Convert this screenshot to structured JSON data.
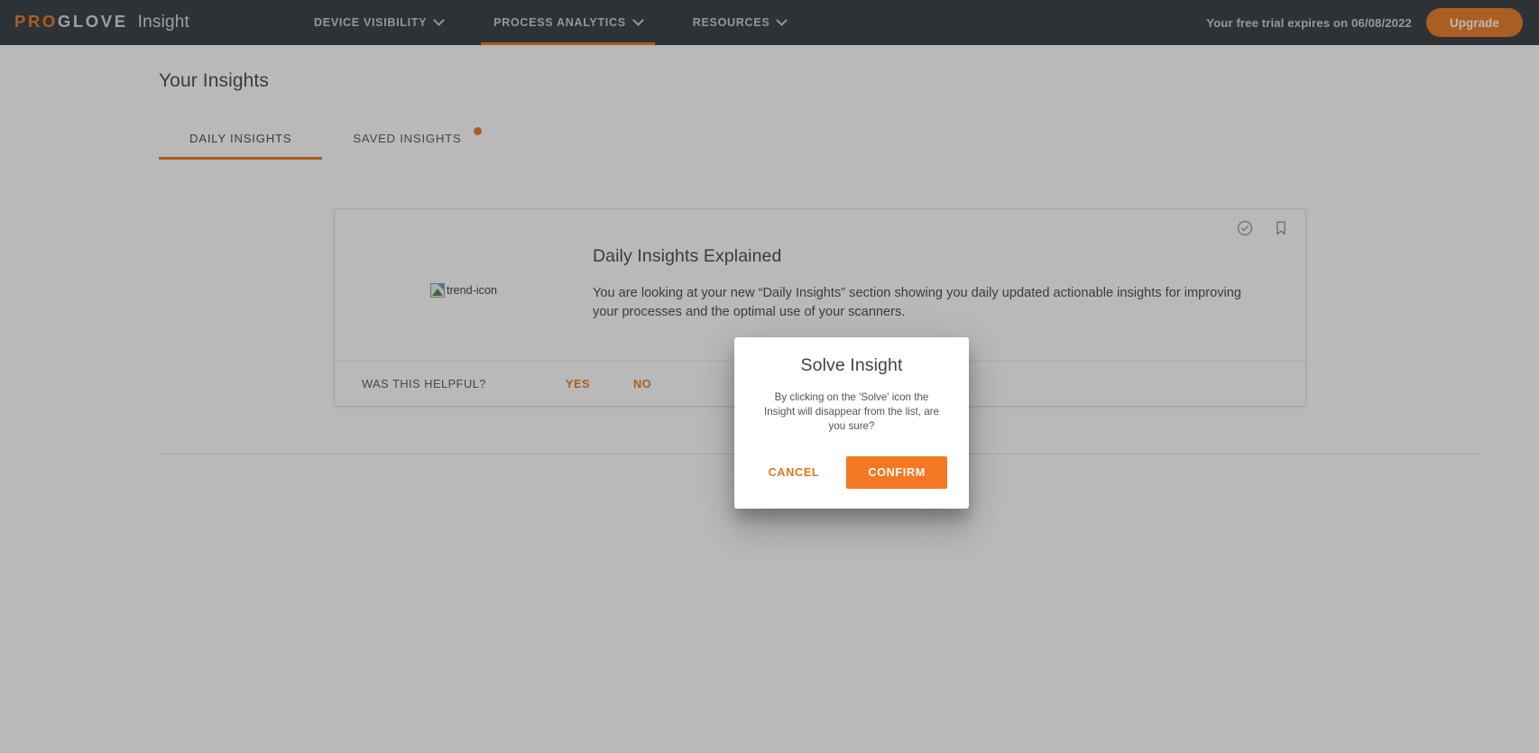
{
  "navbar": {
    "brand": {
      "logo_prefix": "PRO",
      "logo_suffix": "GLOVE",
      "product": "Insight"
    },
    "items": [
      {
        "label": "DEVICE VISIBILITY",
        "has_caret": true,
        "active": false
      },
      {
        "label": "PROCESS ANALYTICS",
        "has_caret": true,
        "active": true
      },
      {
        "label": "RESOURCES",
        "has_caret": true,
        "active": false
      }
    ],
    "trial_notice": "Your free trial expires on 06/08/2022",
    "upgrade_label": "Upgrade",
    "bg_color": "#2b3239",
    "accent_color": "#e8751a"
  },
  "page": {
    "title": "Your Insights",
    "tabs": [
      {
        "label": "DAILY INSIGHTS",
        "active": true,
        "badge": false
      },
      {
        "label": "SAVED INSIGHTS",
        "active": false,
        "badge": true
      }
    ]
  },
  "insight_card": {
    "illustration_alt": "trend-icon",
    "title": "Daily Insights Explained",
    "body": "You are looking at your new “Daily Insights” section showing you daily updated actionable insights for improving your processes and the optimal use of your scanners.",
    "actions": {
      "solve_icon": "check-circle-icon",
      "save_icon": "bookmark-icon"
    },
    "footer": {
      "question": "WAS THIS HELPFUL?",
      "yes_label": "YES",
      "no_label": "NO"
    }
  },
  "modal": {
    "title": "Solve Insight",
    "body": "By clicking on the 'Solve' icon the Insight will disappear from the list, are you sure?",
    "cancel_label": "CANCEL",
    "confirm_label": "CONFIRM",
    "confirm_color": "#f47722"
  }
}
